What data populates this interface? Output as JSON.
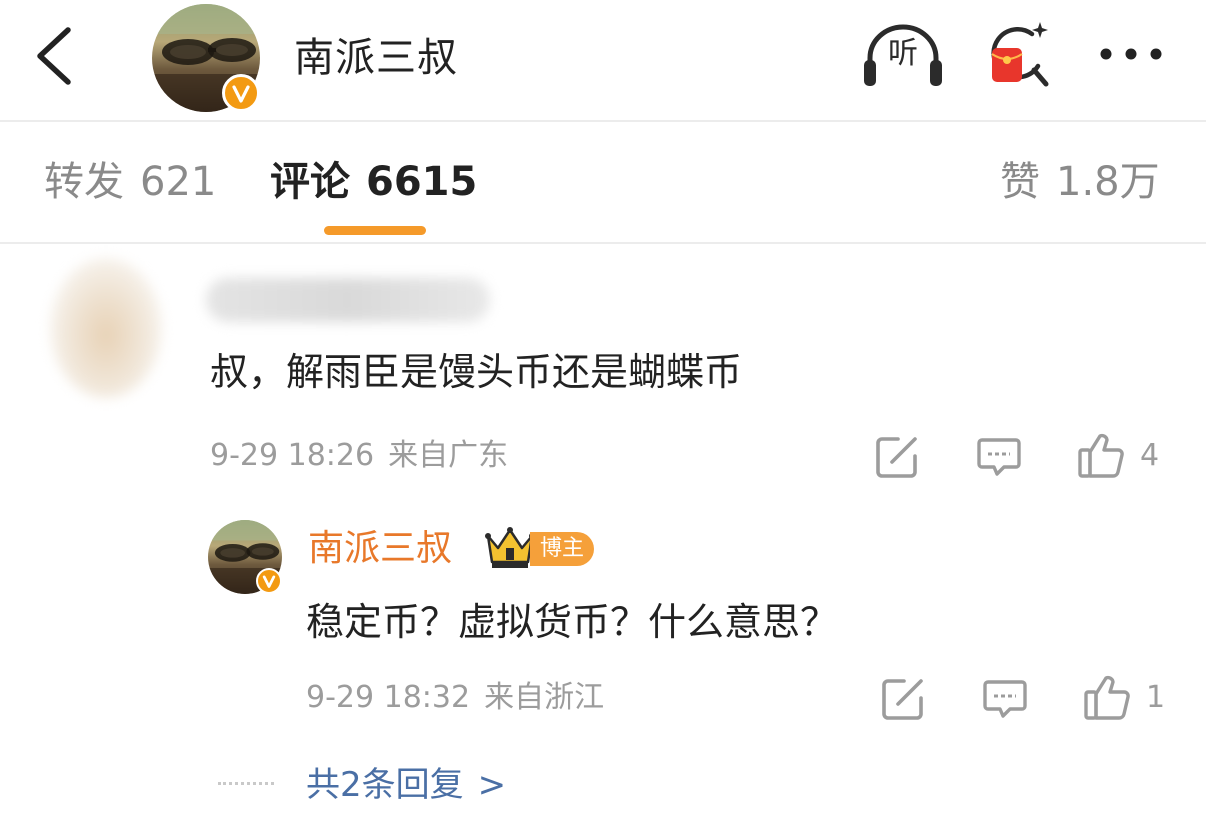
{
  "header": {
    "title": "南派三叔",
    "listen_label": "听"
  },
  "tabs": {
    "forward": {
      "label": "转发",
      "count": "621"
    },
    "comment": {
      "label": "评论",
      "count": "6615"
    },
    "like": {
      "label": "赞",
      "count": "1.8万"
    }
  },
  "comments": [
    {
      "text": "叔，解雨臣是馒头币还是蝴蝶币",
      "time": "9-29 18:26",
      "location": "来自广东",
      "likes": "4"
    }
  ],
  "reply": {
    "author": "南派三叔",
    "badge": "博主",
    "text": "稳定币？虚拟货币？什么意思？",
    "time": "9-29 18:32",
    "location": "来自浙江",
    "likes": "1"
  },
  "more_replies": {
    "label": "共2条回复",
    "chevron": ">"
  },
  "colors": {
    "accent_orange": "#f59a2a",
    "author_name": "#e8782a",
    "link_blue": "#4a6fa5",
    "muted_text": "#9c9c9c",
    "verified_badge": "#f39a12"
  },
  "icons": {
    "back": "chevron-left-icon",
    "listen": "headphones-icon",
    "redpacket": "red-packet-search-icon",
    "more": "more-dots-icon",
    "repost": "repost-edit-icon",
    "comment": "comment-bubble-icon",
    "like": "thumbs-up-icon",
    "verified": "verified-v-icon",
    "crown": "crown-icon"
  }
}
